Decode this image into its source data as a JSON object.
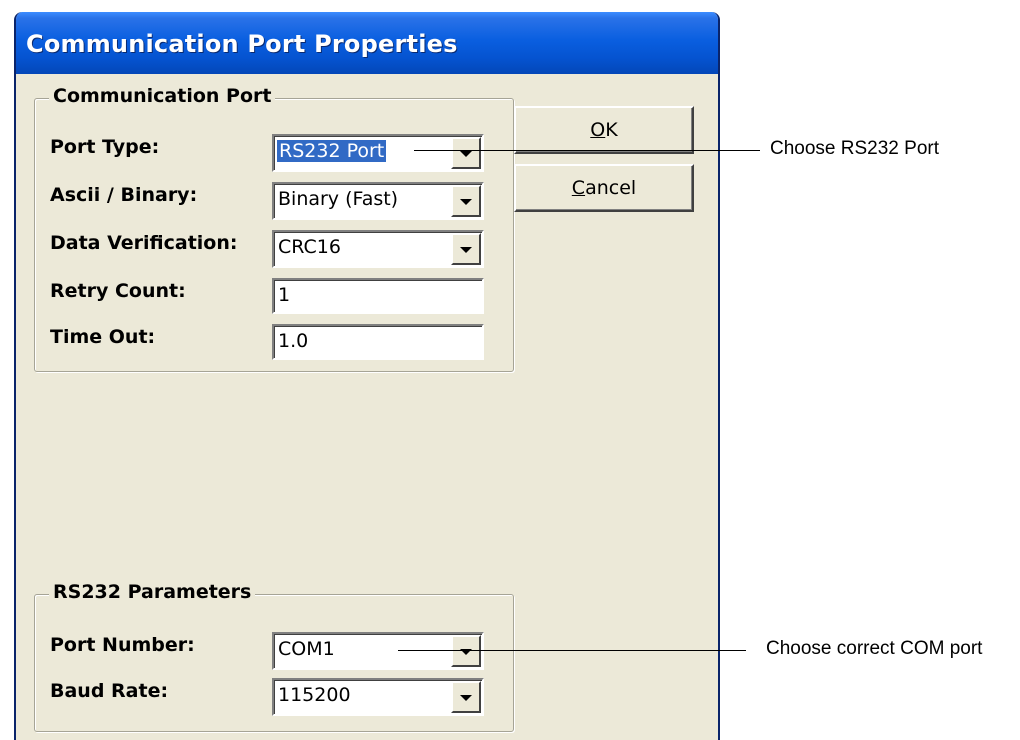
{
  "window": {
    "title": "Communication Port Properties"
  },
  "comm_port_group": {
    "title": "Communication Port",
    "fields": [
      {
        "label": "Port Type:",
        "value": "RS232 Port",
        "type": "dropdown",
        "selected": true
      },
      {
        "label": "Ascii / Binary:",
        "value": "Binary (Fast)",
        "type": "dropdown"
      },
      {
        "label": "Data Verification:",
        "value": "CRC16",
        "type": "dropdown"
      },
      {
        "label": "Retry Count:",
        "value": "1",
        "type": "text"
      },
      {
        "label": "Time Out:",
        "value": "1.0",
        "type": "text"
      }
    ]
  },
  "rs232_group": {
    "title": "RS232 Parameters",
    "fields": [
      {
        "label": "Port Number:",
        "value": "COM1",
        "type": "dropdown"
      },
      {
        "label": "Baud Rate:",
        "value": "115200",
        "type": "dropdown"
      }
    ]
  },
  "buttons": {
    "ok_mnemonic": "O",
    "ok_rest": "K",
    "cancel_mnemonic": "C",
    "cancel_rest": "ancel"
  },
  "callouts": {
    "port_type": "Choose RS232 Port",
    "com_port": "Choose correct COM port"
  },
  "colors": {
    "titlebar": "#0553d0",
    "dialog_bg": "#ece9d8",
    "selection": "#316ac5"
  }
}
